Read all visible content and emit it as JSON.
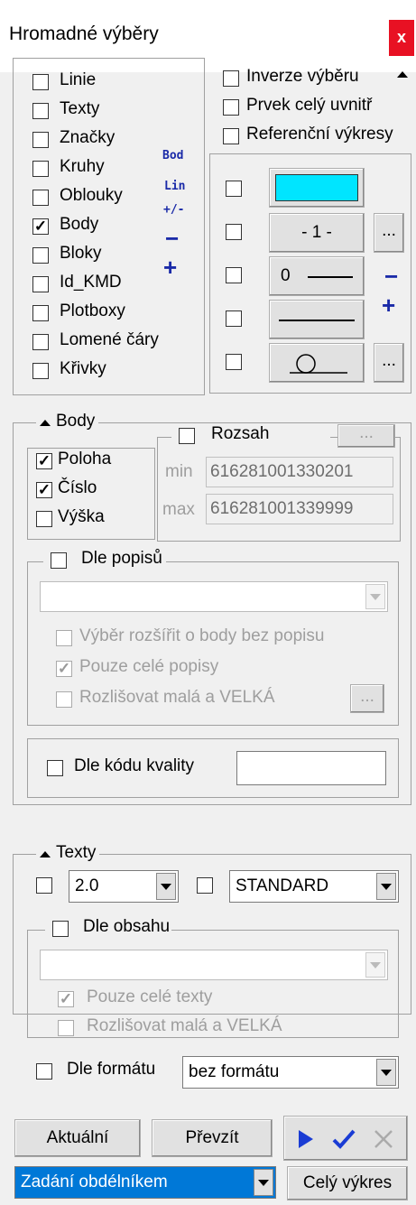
{
  "window": {
    "title": "Hromadné výběry",
    "close": "x"
  },
  "types": {
    "items": [
      {
        "label": "Linie",
        "checked": false
      },
      {
        "label": "Texty",
        "checked": false
      },
      {
        "label": "Značky",
        "checked": false
      },
      {
        "label": "Kruhy",
        "checked": false
      },
      {
        "label": "Oblouky",
        "checked": false
      },
      {
        "label": "Body",
        "checked": true
      },
      {
        "label": "Bloky",
        "checked": false
      },
      {
        "label": "Id_KMD",
        "checked": false
      },
      {
        "label": "Plotboxy",
        "checked": false
      },
      {
        "label": "Lomené čáry",
        "checked": false
      },
      {
        "label": "Křivky",
        "checked": false
      }
    ],
    "bod": "Bod",
    "lin": "Lin",
    "plusminus": "+/-",
    "minus": "−",
    "plus": "+"
  },
  "options": {
    "inverze": "Inverze výběru",
    "prvek": "Prvek celý uvnitř",
    "referencni": "Referenční výkresy"
  },
  "props": {
    "layer_color": "#00e5ff",
    "level": "- 1 -",
    "linetype": "0",
    "ellipsis": "...",
    "minus": "−",
    "plus": "+"
  },
  "body": {
    "title": "Body",
    "poloha": "Poloha",
    "cislo": "Číslo",
    "vyska": "Výška",
    "rozsah": "Rozsah",
    "min_label": "min",
    "max_label": "max",
    "min_value": "616281001330201",
    "max_value": "616281001339999",
    "dle_popisu": "Dle popisů",
    "rozsirit": "Výběr rozšířit o body bez popisu",
    "pouze_cele": "Pouze celé popisy",
    "rozlisovat": "Rozlišovat malá a VELKÁ",
    "dle_kodu": "Dle kódu kvality"
  },
  "texty": {
    "title": "Texty",
    "size": "2.0",
    "style": "STANDARD",
    "dle_obsahu": "Dle obsahu",
    "pouze_cele": "Pouze celé texty",
    "rozlisovat": "Rozlišovat malá a VELKÁ",
    "dle_formatu": "Dle formátu",
    "format": "bez formátu"
  },
  "footer": {
    "aktualni": "Aktuální",
    "prevzit": "Převzít",
    "zadani": "Zadání obdélníkem",
    "cely": "Celý výkres"
  }
}
